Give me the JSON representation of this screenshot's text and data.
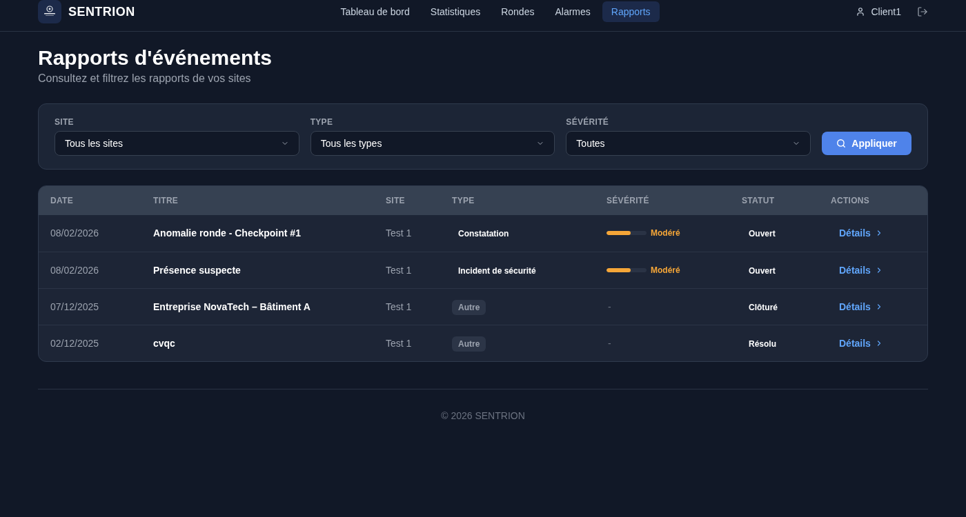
{
  "header": {
    "brand": "SENTRION",
    "nav": [
      {
        "label": "Tableau de bord",
        "selected": false
      },
      {
        "label": "Statistiques",
        "selected": false
      },
      {
        "label": "Rondes",
        "selected": false
      },
      {
        "label": "Alarmes",
        "selected": false
      },
      {
        "label": "Rapports",
        "selected": true
      }
    ],
    "user": "Client1"
  },
  "page": {
    "title": "Rapports d'événements",
    "subtitle": "Consultez et filtrez les rapports de vos sites"
  },
  "filters": {
    "fields": [
      {
        "label": "SITE",
        "value": "Tous les sites"
      },
      {
        "label": "TYPE",
        "value": "Tous les types"
      },
      {
        "label": "SÉVÉRITÉ",
        "value": "Toutes"
      }
    ],
    "apply_button": "Appliquer"
  },
  "table": {
    "columns": [
      "DATE",
      "TITRE",
      "SITE",
      "TYPE",
      "SÉVÉRITÉ",
      "STATUT",
      "ACTIONS"
    ],
    "rows": [
      {
        "date": "08/02/2026",
        "title": "Anomalie ronde - Checkpoint #1",
        "site": "Test 1",
        "type": {
          "label": "Constatation",
          "muted": false
        },
        "severity": {
          "kind": "meter",
          "level": 0.6,
          "label": "Modéré",
          "color": "#f5a638"
        },
        "status": "Ouvert",
        "action": "Détails"
      },
      {
        "date": "08/02/2026",
        "title": "Présence suspecte",
        "site": "Test 1",
        "type": {
          "label": "Incident de sécurité",
          "muted": false
        },
        "severity": {
          "kind": "meter",
          "level": 0.6,
          "label": "Modéré",
          "color": "#f5a638"
        },
        "status": "Ouvert",
        "action": "Détails"
      },
      {
        "date": "07/12/2025",
        "title": "Entreprise NovaTech – Bâtiment A",
        "site": "Test 1",
        "type": {
          "label": "Autre",
          "muted": true
        },
        "severity": {
          "kind": "none",
          "label": "-"
        },
        "status": "Clôturé",
        "action": "Détails"
      },
      {
        "date": "02/12/2025",
        "title": "cvqc",
        "site": "Test 1",
        "type": {
          "label": "Autre",
          "muted": true
        },
        "severity": {
          "kind": "none",
          "label": "-"
        },
        "status": "Résolu",
        "action": "Détails"
      }
    ]
  },
  "footer": "© 2026 SENTRION"
}
